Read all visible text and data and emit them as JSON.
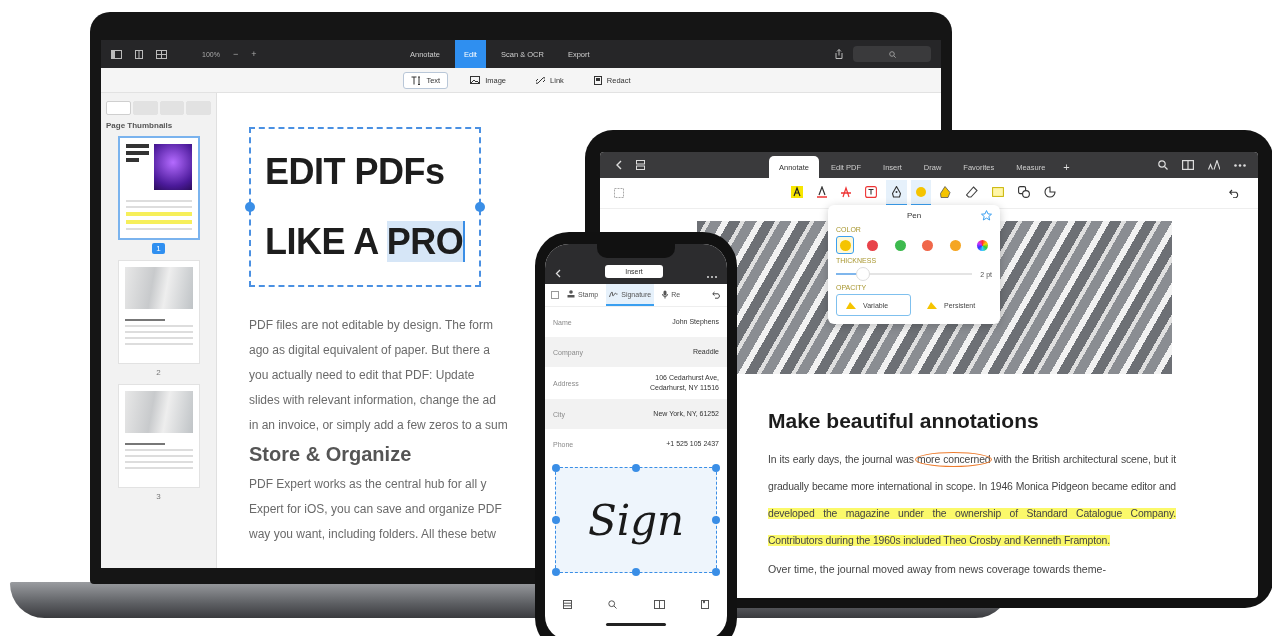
{
  "laptop": {
    "toolbar": {
      "zoom": "100%",
      "zoom_out": "−",
      "zoom_in": "+",
      "tabs": [
        {
          "label": "Annotate",
          "selected": false
        },
        {
          "label": "Edit",
          "selected": true
        },
        {
          "label": "Scan & OCR",
          "selected": false
        },
        {
          "label": "Export",
          "selected": false
        }
      ]
    },
    "edit_tools": [
      {
        "kind": "text",
        "label": "Text",
        "selected": true
      },
      {
        "kind": "image",
        "label": "Image",
        "selected": false
      },
      {
        "kind": "link",
        "label": "Link",
        "selected": false
      },
      {
        "kind": "redact",
        "label": "Redact",
        "selected": false
      }
    ],
    "sidebar": {
      "tabs": [
        {
          "selected": true
        },
        {
          "selected": false
        },
        {
          "selected": false
        },
        {
          "selected": false
        }
      ],
      "title": "Page Thumbnails",
      "pages": [
        {
          "kind": "cover",
          "number": "1",
          "selected": true
        },
        {
          "kind": "article",
          "number": "2",
          "selected": false
        },
        {
          "kind": "article",
          "number": "3",
          "selected": false
        }
      ]
    },
    "document": {
      "title_lines": [
        [
          {
            "text": "EDIT PDFs",
            "selected": false
          }
        ],
        [
          {
            "text": "LIKE A ",
            "selected": false
          },
          {
            "text": "PRO",
            "selected": true
          }
        ]
      ],
      "paragraph_1": [
        "PDF files are not editable by design. The form",
        "ago as digital equivalent of paper. But there a",
        "you actually need to edit that PDF: Update",
        "slides with relevant information, change the ad",
        "in an invoice, or simply add a few zeros to a sum"
      ],
      "heading": "Store & Organize",
      "paragraph_2": [
        "PDF Expert works as the central hub for all y",
        "Expert for iOS, you can save and organize PDF",
        "way you want, including folders. All these betw"
      ]
    }
  },
  "tablet": {
    "tabs": [
      {
        "label": "Annotate",
        "selected": true
      },
      {
        "label": "Edit PDF",
        "selected": false
      },
      {
        "label": "Insert",
        "selected": false
      },
      {
        "label": "Draw",
        "selected": false
      },
      {
        "label": "Favorites",
        "selected": false
      },
      {
        "label": "Measure",
        "selected": false
      }
    ],
    "add_tab": "+",
    "tools": [
      {
        "kind": "highlight",
        "selected": false
      },
      {
        "kind": "underline",
        "selected": false
      },
      {
        "kind": "strikeout",
        "selected": false
      },
      {
        "kind": "textbox",
        "selected": false
      },
      {
        "kind": "pen",
        "selected": true
      },
      {
        "kind": "color",
        "selected": true
      },
      {
        "kind": "marker",
        "selected": false
      },
      {
        "kind": "eraser",
        "selected": false
      },
      {
        "kind": "note",
        "selected": false
      },
      {
        "kind": "shapes",
        "selected": false
      },
      {
        "kind": "lasso",
        "selected": false
      }
    ],
    "pen_popover": {
      "title": "Pen",
      "color_label": "COLOR",
      "colors": [
        {
          "kind": "solid",
          "color": "#f5c400",
          "selected": true
        },
        {
          "kind": "solid",
          "color": "#e8434a",
          "selected": false
        },
        {
          "kind": "solid",
          "color": "#3dba4e",
          "selected": false
        },
        {
          "kind": "solid",
          "color": "#f0674a",
          "selected": false
        },
        {
          "kind": "solid",
          "color": "#f5a623",
          "selected": false
        },
        {
          "kind": "wheel",
          "selected": false
        }
      ],
      "thickness_label": "THICKNESS",
      "thickness": {
        "level": 0.2
      },
      "thickness_reading": "2 pt",
      "opacity_label": "OPACITY",
      "opacity_options": [
        {
          "label": "Variable",
          "selected": true
        },
        {
          "label": "Persistent",
          "selected": false
        }
      ]
    },
    "heading": "Make beautiful annotations",
    "paragraph_1": [
      {
        "kind": "plain",
        "text": "In its early days, the journal was "
      },
      {
        "kind": "circled",
        "text": "more concerned"
      },
      {
        "kind": "plain",
        "text": " with the British architectural scene, but it gradually became more international in scope. In 1946 Monica Pidgeon became editor and "
      },
      {
        "kind": "highlighted",
        "text": "developed the magazine under the ownership of Standard Catalogue Company. Contributors during the 1960s included Theo Crosby and Kenneth Frampton."
      }
    ],
    "paragraph_2": "Over time, the journal moved away from news coverage towards theme-"
  },
  "phone": {
    "menu": "Insert",
    "tools": [
      {
        "kind": "stamp",
        "label": "Stamp",
        "selected": false
      },
      {
        "kind": "signature",
        "label": "Signature",
        "selected": true
      },
      {
        "kind": "audio",
        "label": "Re",
        "selected": false
      }
    ],
    "form": [
      {
        "label": "Name",
        "value": [
          "John Stephens"
        ]
      },
      {
        "label": "Company",
        "value": [
          "Readdle"
        ]
      },
      {
        "label": "Address",
        "value": [
          "106 Cedarhurst Ave,",
          "Cedarhurst, NY 11516"
        ]
      },
      {
        "label": "City",
        "value": [
          "New York, NY, 61252"
        ]
      },
      {
        "label": "Phone",
        "value": [
          "+1 525 105 2437"
        ]
      }
    ],
    "signature": "Sign"
  }
}
